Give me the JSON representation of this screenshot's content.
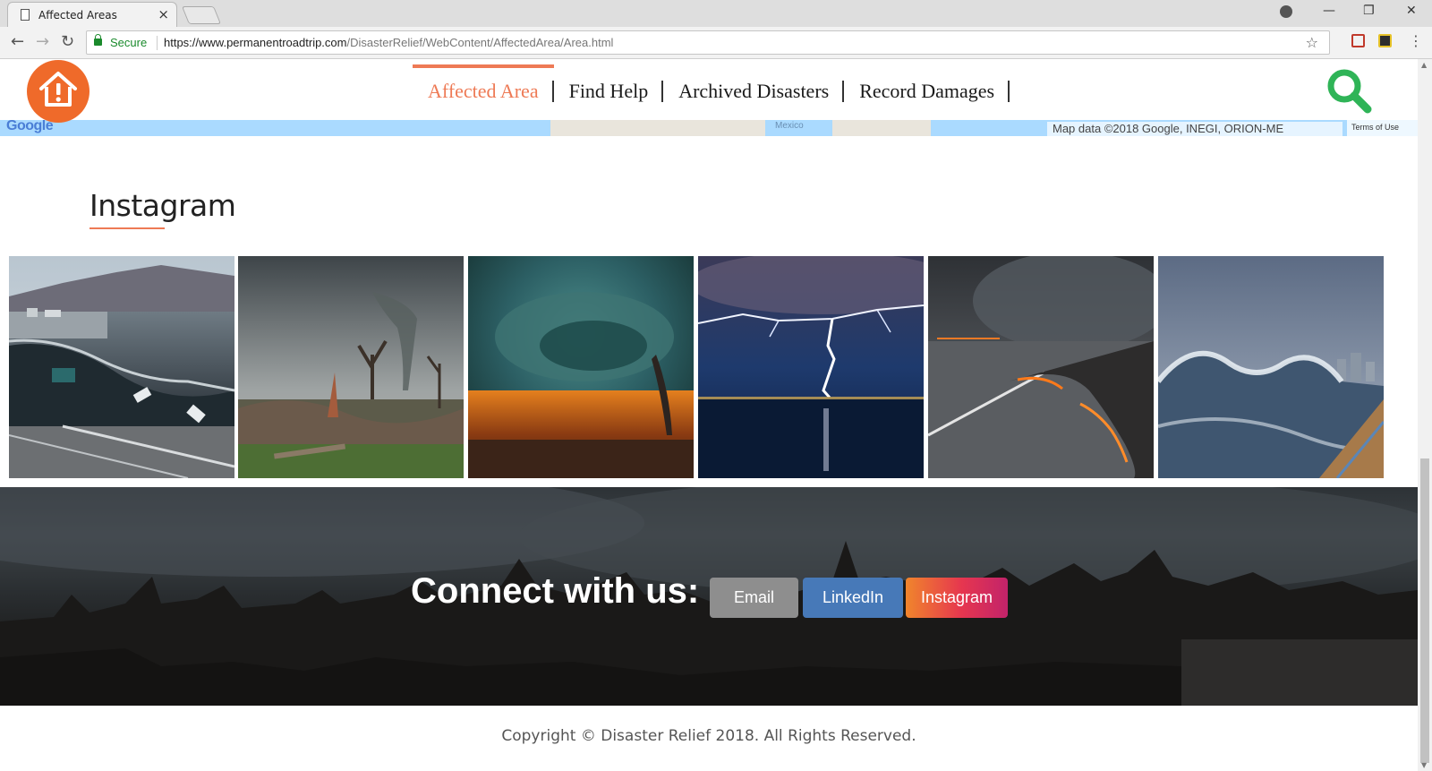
{
  "browser": {
    "tab_title": "Affected Areas",
    "tab_close": "×",
    "secure_label": "Secure",
    "url_host": "https://www.permanentroadtrip.com",
    "url_path": "/DisasterRelief/WebContent/AffectedArea/Area.html",
    "win_minimize": "—",
    "win_restore": "❐",
    "win_close": "✕",
    "nav_back": "←",
    "nav_forward": "→",
    "nav_reload": "↻",
    "star": "☆",
    "menu": "⋮"
  },
  "map": {
    "google_label": "Google",
    "gulf_label": "Mexico",
    "map_data": "Map data ©2018 Google, INEGI, ORION-ME",
    "terms": "Terms of Use"
  },
  "header": {
    "nav": [
      {
        "label": "Affected Area",
        "active": true
      },
      {
        "label": "Find Help",
        "active": false
      },
      {
        "label": "Archived Disasters",
        "active": false
      },
      {
        "label": "Record Damages",
        "active": false
      }
    ],
    "accent_color": "#ee7a55",
    "logo_color": "#ef6a2a",
    "search_color": "#2fb457"
  },
  "instagram": {
    "title": "Instagram",
    "photos": [
      {
        "icon": "tsunami-city-photo"
      },
      {
        "icon": "tornado-debris-photo"
      },
      {
        "icon": "tornado-sunset-photo"
      },
      {
        "icon": "lightning-sea-photo"
      },
      {
        "icon": "lava-road-photo"
      },
      {
        "icon": "giant-wave-photo"
      }
    ]
  },
  "connect": {
    "title": "Connect with us:",
    "buttons": {
      "email": "Email",
      "linkedin": "LinkedIn",
      "instagram": "Instagram"
    }
  },
  "footer": {
    "copyright": "Copyright © Disaster Relief 2018. All Rights Reserved."
  }
}
